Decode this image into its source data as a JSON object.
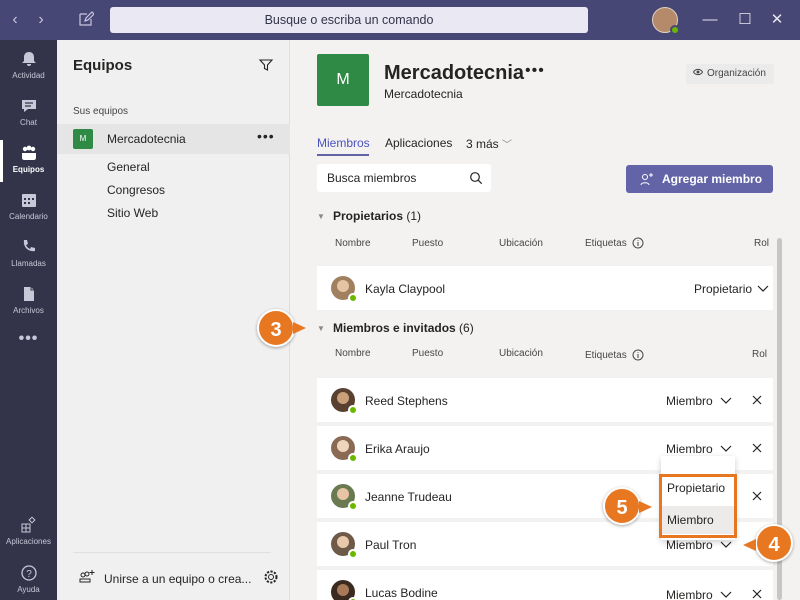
{
  "titlebar": {
    "search_placeholder": "Busque o escriba un comando"
  },
  "appbar": {
    "items": [
      {
        "label": "Actividad",
        "icon": "bell-icon"
      },
      {
        "label": "Chat",
        "icon": "chat-icon"
      },
      {
        "label": "Equipos",
        "icon": "teams-icon",
        "active": true
      },
      {
        "label": "Calendario",
        "icon": "calendar-icon"
      },
      {
        "label": "Llamadas",
        "icon": "phone-icon"
      },
      {
        "label": "Archivos",
        "icon": "file-icon"
      },
      {
        "label": "Aplicaciones",
        "icon": "apps-icon"
      },
      {
        "label": "Ayuda",
        "icon": "help-icon"
      }
    ],
    "more": "•••"
  },
  "leftpanel": {
    "title": "Equipos",
    "section_label": "Sus equipos",
    "team": {
      "initial": "M",
      "name": "Mercadotecnia",
      "more": "•••"
    },
    "channels": [
      "General",
      "Congresos",
      "Sitio Web"
    ],
    "join_label": "Unirse a un equipo o crea..."
  },
  "main": {
    "team_initial": "M",
    "title": "Mercadotecnia",
    "title_more": "•••",
    "subtitle": "Mercadotecnia",
    "org_badge": "Organización",
    "tabs": [
      "Miembros",
      "Aplicaciones",
      "3 más"
    ],
    "search_placeholder": "Busca miembros",
    "add_member_label": "Agregar miembro",
    "owners": {
      "title": "Propietarios",
      "count": "(1)",
      "columns": [
        "Nombre",
        "Puesto",
        "Ubicación",
        "Etiquetas",
        "Rol"
      ],
      "rows": [
        {
          "name": "Kayla Claypool",
          "role": "Propietario"
        }
      ]
    },
    "members": {
      "title": "Miembros e invitados",
      "count": "(6)",
      "columns": [
        "Nombre",
        "Puesto",
        "Ubicación",
        "Etiquetas",
        "Rol"
      ],
      "rows": [
        {
          "name": "Reed Stephens",
          "role": "Miembro"
        },
        {
          "name": "Erika Araujo",
          "role": "Miembro"
        },
        {
          "name": "Jeanne Trudeau",
          "role": ""
        },
        {
          "name": "Paul Tron",
          "role": "Miembro"
        },
        {
          "name": "Lucas Bodine",
          "role": "Miembro"
        }
      ]
    },
    "role_dropdown": {
      "options": [
        "Propietario",
        "Miembro"
      ],
      "highlighted": "Miembro"
    }
  },
  "callouts": [
    "3",
    "4",
    "5"
  ],
  "colors": {
    "titlebar": "#464775",
    "appbar": "#33344a",
    "accent": "#6264a7",
    "team_tile": "#2e8a45",
    "callout": "#e87722",
    "presence": "#6bb700"
  }
}
